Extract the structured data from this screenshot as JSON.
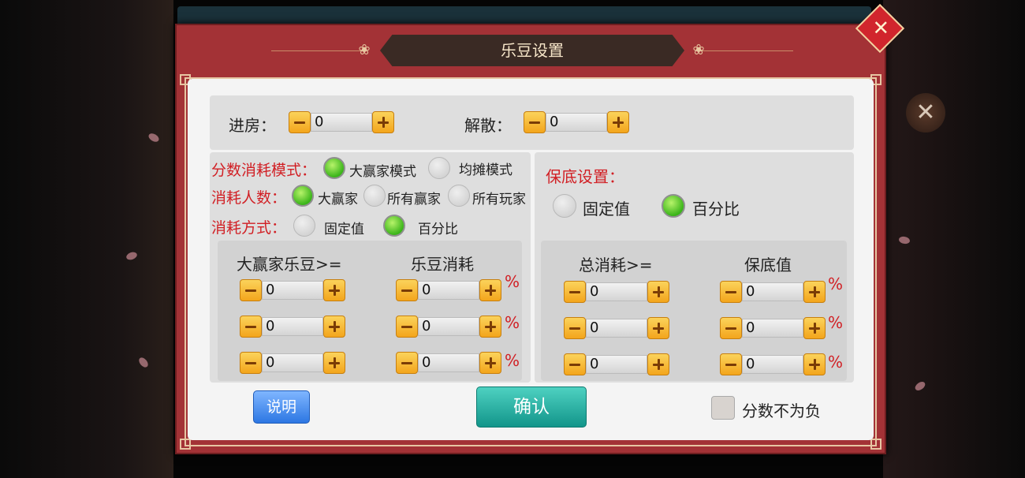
{
  "dialog": {
    "title": "乐豆设置",
    "title_ornament": "❀",
    "close_glyph": "✕",
    "plus_glyph": "+",
    "close_icon": "close-icon"
  },
  "top_row": {
    "enter_label": "进房：",
    "enter_value": "0",
    "dissolve_label": "解散：",
    "dissolve_value": "0"
  },
  "left_section": {
    "score_mode_label": "分数消耗模式：",
    "score_mode_options": [
      "大赢家模式",
      "均摊模式"
    ],
    "score_mode_selected": "大赢家模式",
    "consumer_label": "消耗人数：",
    "consumer_options": [
      "大赢家",
      "所有赢家",
      "所有玩家"
    ],
    "consumer_selected": "大赢家",
    "method_label": "消耗方式：",
    "method_options": [
      "固定值",
      "百分比"
    ],
    "method_selected": "百分比",
    "col1_header": "大赢家乐豆>=",
    "col2_header": "乐豆消耗",
    "rows": [
      {
        "threshold": "0",
        "cost": "0",
        "unit": "%"
      },
      {
        "threshold": "0",
        "cost": "0",
        "unit": "%"
      },
      {
        "threshold": "0",
        "cost": "0",
        "unit": "%"
      }
    ]
  },
  "right_section": {
    "guarantee_label": "保底设置：",
    "guarantee_options": [
      "固定值",
      "百分比"
    ],
    "guarantee_selected": "百分比",
    "col1_header": "总消耗>=",
    "col2_header": "保底值",
    "rows": [
      {
        "threshold": "0",
        "value": "0",
        "unit": "%"
      },
      {
        "threshold": "0",
        "value": "0",
        "unit": "%"
      },
      {
        "threshold": "0",
        "value": "0",
        "unit": "%"
      }
    ]
  },
  "footer": {
    "help_label": "说明",
    "confirm_label": "确认",
    "nonnegative_label": "分数不为负",
    "nonnegative_checked": false
  },
  "colors": {
    "frame_red": "#a33236",
    "accent_red": "#d11f24",
    "radio_green": "#3bb51a",
    "confirm_teal": "#12958a",
    "help_blue": "#2d77e3",
    "stepper_orange": "#f3a51c"
  }
}
